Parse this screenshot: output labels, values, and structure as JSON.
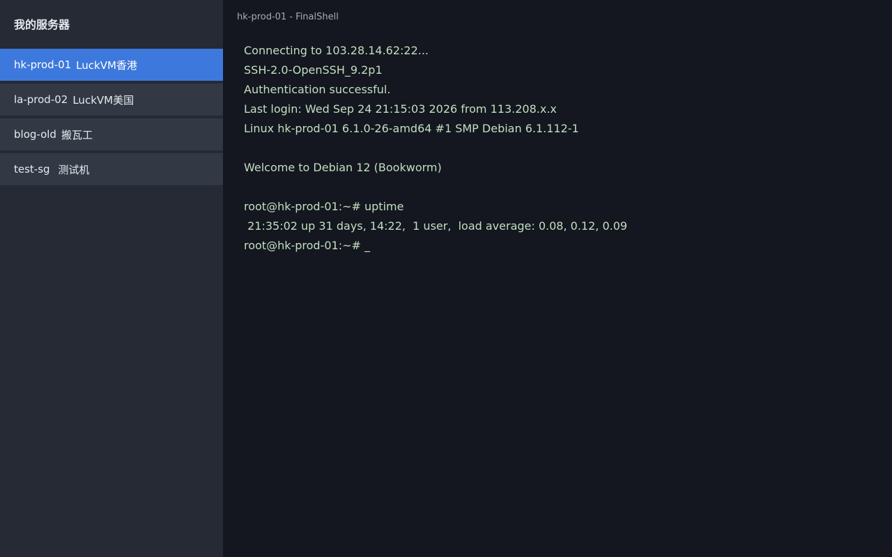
{
  "sidebar": {
    "title": "我的服务器",
    "servers": [
      {
        "name": "hk-prod-01",
        "desc": "LuckVM香港",
        "active": true
      },
      {
        "name": "la-prod-02",
        "desc": "LuckVM美国",
        "active": false
      },
      {
        "name": "blog-old",
        "desc": "搬瓦工",
        "active": false
      },
      {
        "name": "test-sg",
        "desc": " 测试机",
        "active": false
      }
    ]
  },
  "main": {
    "window_title": "hk-prod-01 - FinalShell",
    "terminal_lines": [
      "Connecting to 103.28.14.62:22...",
      "SSH-2.0-OpenSSH_9.2p1",
      "Authentication successful.",
      "Last login: Wed Sep 24 21:15:03 2026 from 113.208.x.x",
      "Linux hk-prod-01 6.1.0-26-amd64 #1 SMP Debian 6.1.112-1",
      "",
      "Welcome to Debian 12 (Bookworm)",
      "",
      "root@hk-prod-01:~# uptime",
      " 21:35:02 up 31 days, 14:22,  1 user,  load average: 0.08, 0.12, 0.09",
      "root@hk-prod-01:~# _"
    ]
  },
  "colors": {
    "sidebar_bg": "#252a34",
    "item_bg": "#323844",
    "active_item_bg": "#3d79dc",
    "terminal_bg": "#14171f",
    "terminal_text": "#c3dfc2"
  }
}
